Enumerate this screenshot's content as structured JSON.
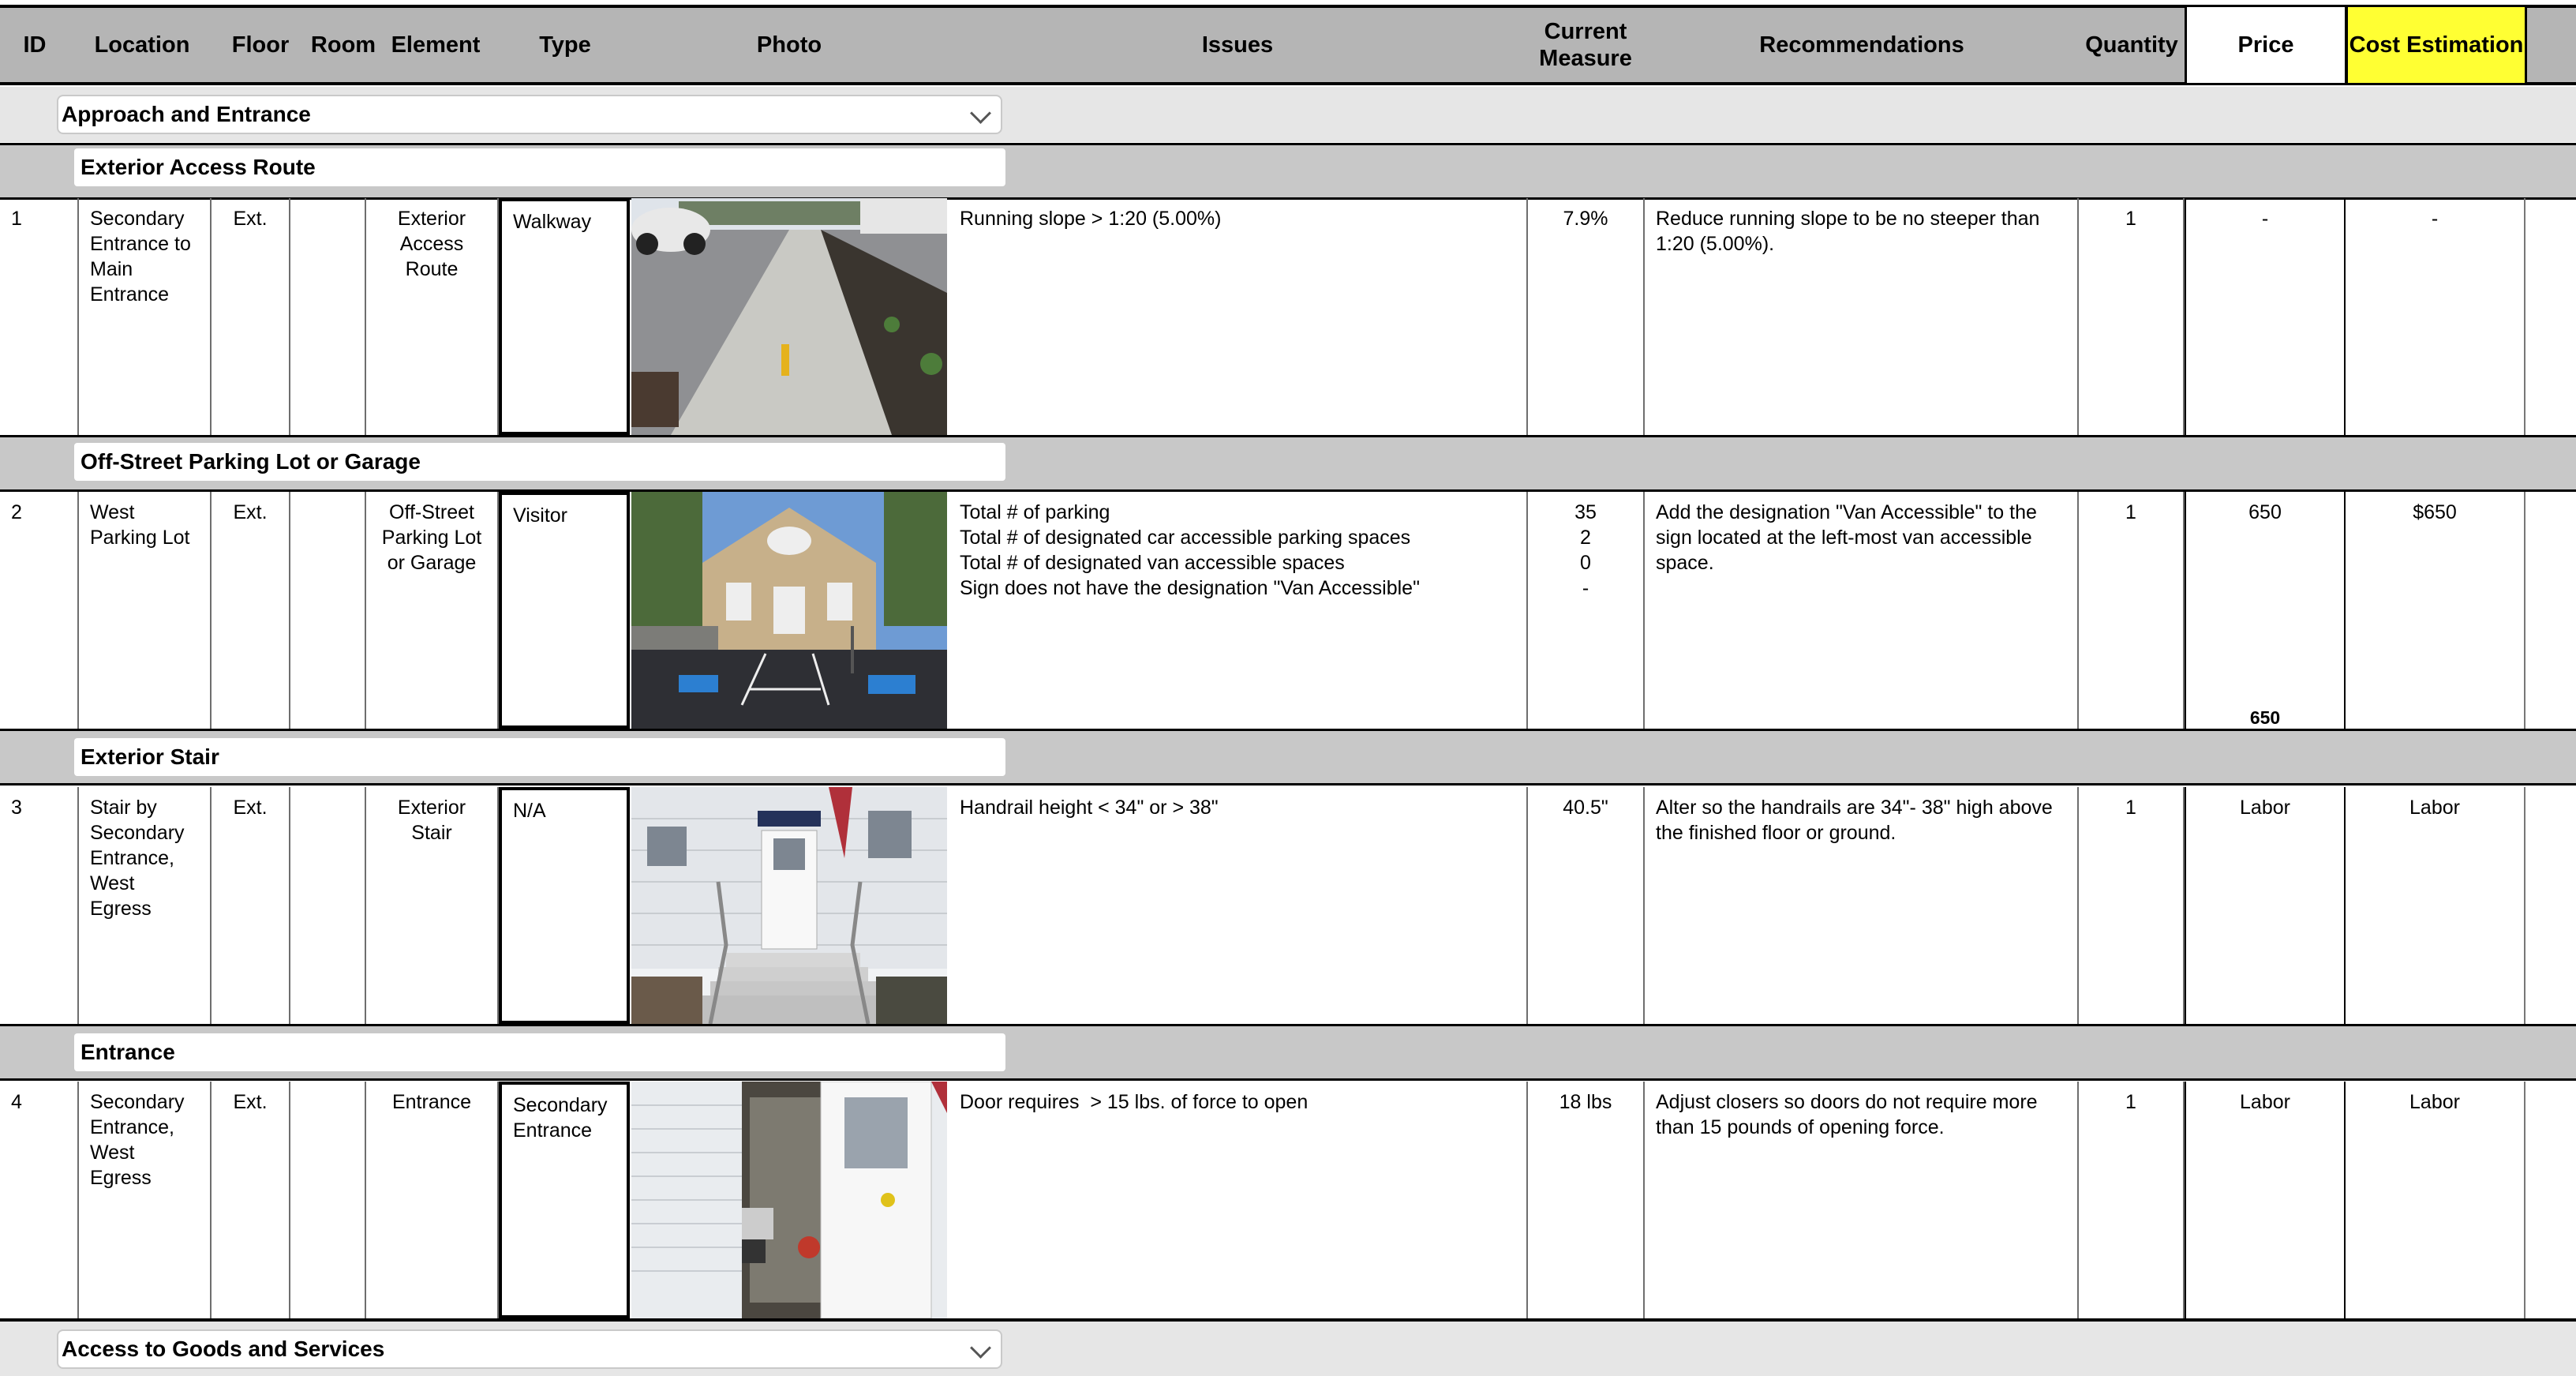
{
  "headers": {
    "id": "ID",
    "location": "Location",
    "floor": "Floor",
    "room": "Room",
    "element": "Element",
    "type": "Type",
    "photo": "Photo",
    "issues": "Issues",
    "current_measure": "Current Measure",
    "recommendations": "Recommendations",
    "quantity": "Quantity",
    "price": "Price",
    "cost_estimation": "Cost Estimation"
  },
  "colors": {
    "header_bg": "#b5b5b5",
    "cost_highlight": "#ffff33",
    "category_bg": "#e6e6e6",
    "subsection_bg": "#c8c8c8"
  },
  "categories": [
    {
      "label": "Approach and Entrance",
      "icon": "chevron-down-icon"
    },
    {
      "label": "Access to Goods and Services",
      "icon": "chevron-down-icon"
    }
  ],
  "subsections": [
    "Exterior Access Route",
    "Off-Street Parking Lot or Garage",
    "Exterior Stair",
    "Entrance"
  ],
  "rows": [
    {
      "id": "1",
      "location": "Secondary Entrance to Main Entrance",
      "floor": "Ext.",
      "room": "",
      "element": "Exterior Access Route",
      "type": "Walkway",
      "photo": "walkway-photo",
      "issues": [
        "Running slope > 1:20 (5.00%)"
      ],
      "measures": [
        "7.9%"
      ],
      "recommendations": "Reduce running slope to be no steeper than 1:20 (5.00%).",
      "quantity": "1",
      "price": "-",
      "cost": "-",
      "subtotal": ""
    },
    {
      "id": "2",
      "location": "West Parking Lot",
      "floor": "Ext.",
      "room": "",
      "element": "Off-Street Parking Lot or Garage",
      "type": "Visitor",
      "photo": "parking-lot-photo",
      "issues": [
        "Total # of parking",
        "Total # of designated car accessible parking spaces",
        "Total # of designated van accessible spaces",
        "Sign does not have the designation \"Van Accessible\""
      ],
      "measures": [
        "35",
        "2",
        "0",
        "-"
      ],
      "recommendations": "Add the designation \"Van Accessible\" to the sign located at the left-most van accessible space.",
      "quantity": "1",
      "price": "650",
      "cost": "$650",
      "subtotal": "650"
    },
    {
      "id": "3",
      "location": "Stair by Secondary Entrance, West Egress",
      "floor": "Ext.",
      "room": "",
      "element": "Exterior Stair",
      "type": "N/A",
      "photo": "stair-photo",
      "issues": [
        "Handrail height < 34\" or > 38\""
      ],
      "measures": [
        "40.5\""
      ],
      "recommendations": "Alter so the handrails are 34\"- 38\" high above the finished floor or ground.",
      "quantity": "1",
      "price": "Labor",
      "cost": "Labor",
      "subtotal": ""
    },
    {
      "id": "4",
      "location": "Secondary Entrance, West Egress",
      "floor": "Ext.",
      "room": "",
      "element": "Entrance",
      "type": "Secondary Entrance",
      "photo": "entrance-door-photo",
      "issues": [
        "Door requires  > 15 lbs. of force to open"
      ],
      "measures": [
        "18 lbs"
      ],
      "recommendations": "Adjust closers so doors do not require more than 15 pounds of opening force.",
      "quantity": "1",
      "price": "Labor",
      "cost": "Labor",
      "subtotal": ""
    }
  ]
}
